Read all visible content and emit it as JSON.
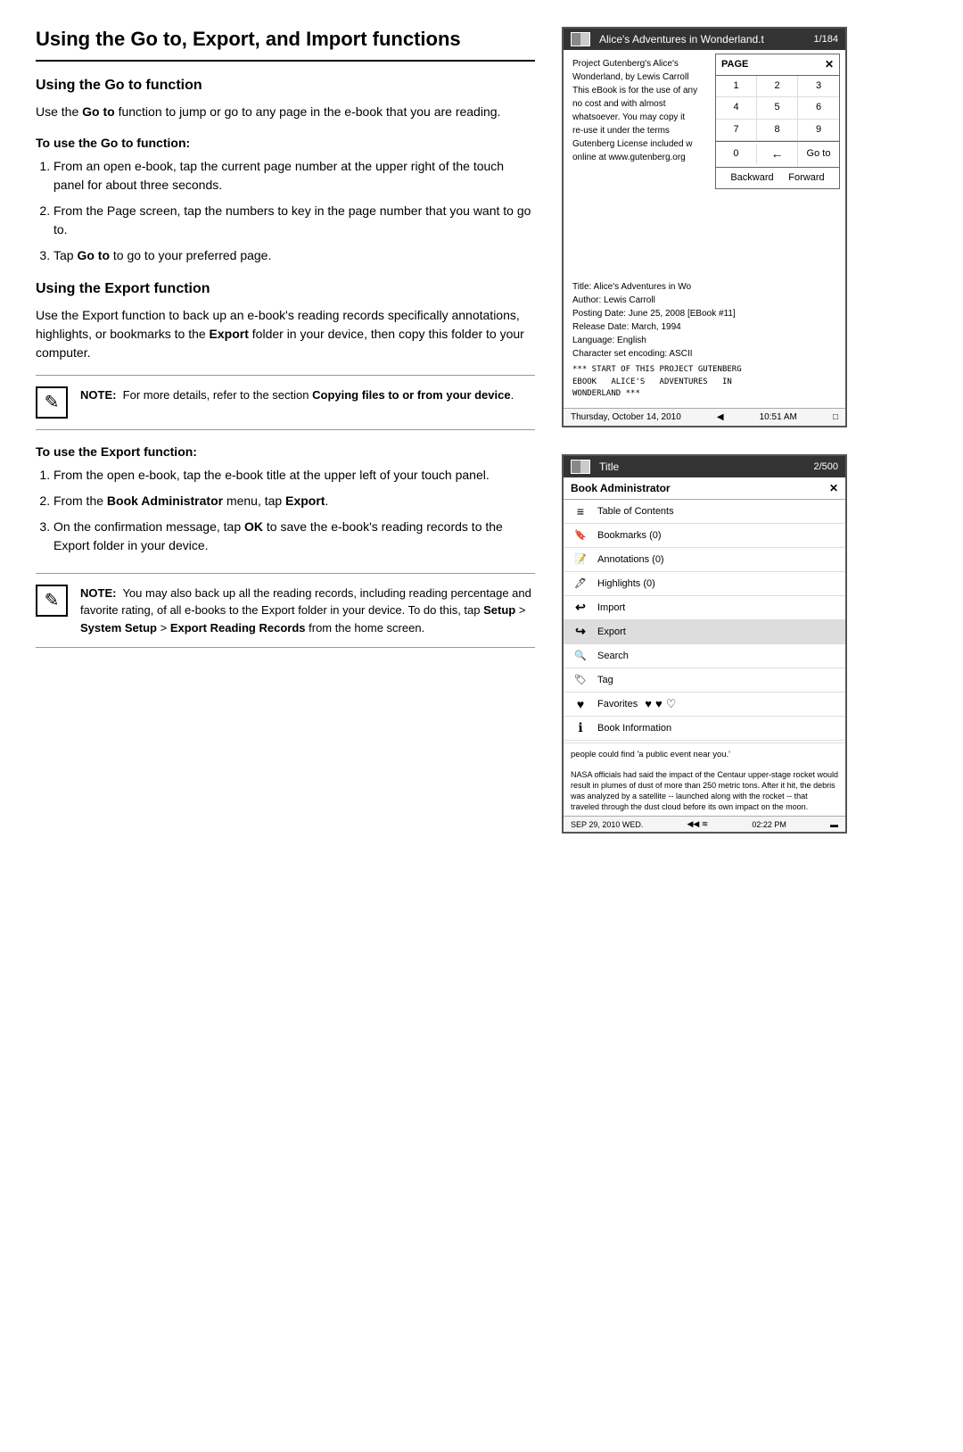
{
  "page": {
    "main_title": "Using the Go to, Export, and Import functions",
    "section1": {
      "title": "Using the Go to function",
      "body": "Use the Go to function to jump or go to any page in the e-book that you are reading.",
      "goto_bold": "Go to",
      "subsection_title": "To use the Go to function:",
      "steps": [
        "From an open e-book, tap the current page number at the upper right of the touch panel for about three seconds.",
        "From the Page screen, tap the numbers to key in the page number that you want to go to.",
        "Tap Go to to go to your preferred page."
      ],
      "step3_bold": "Go to"
    },
    "section2": {
      "title": "Using the Export function",
      "body": "Use the Export function to back up an e-book's reading records specifically annotations, highlights, or bookmarks to the Export folder in your device, then copy this folder to your computer.",
      "export_bold": "Export",
      "note": {
        "label": "NOTE:",
        "text": "For more details, refer to the section Copying files to or from your device.",
        "bold_part": "Copying files to or from your device"
      },
      "subsection_title": "To use the Export function:",
      "steps": [
        "From the open e-book, tap the e-book title at the upper left of your touch panel.",
        "From the Book Administrator menu, tap Export.",
        "On the confirmation message, tap OK to save the e-book's reading records to the Export folder in your device."
      ],
      "step2_bold": "Book Administrator",
      "step2_bold2": "Export",
      "step3_bold": "OK"
    },
    "note_bottom": {
      "label": "NOTE:",
      "text": "You may also back up all the reading records, including reading percentage and favorite rating, of all e-books to the Export folder in your device. To do this, tap Setup > System Setup > Export Reading Records from the home screen.",
      "bold_parts": [
        "Setup",
        "System Setup",
        "Export Reading Records"
      ]
    }
  },
  "device1": {
    "title": "Alice's Adventures in Wonderland.t",
    "page_label": "1/184",
    "body_text": "Project Gutenberg's Alice's Wonderland, by Lewis Carroll This eBook is for the use of any no cost and with almost whatsoever. You may copy it re-use it under the terms Gutenberg License included w online at www.gutenberg.org",
    "page_popup": {
      "header": "PAGE",
      "close": "✕",
      "numbers": [
        "1",
        "2",
        "3",
        "4",
        "5",
        "6",
        "7",
        "8",
        "9"
      ],
      "zero": "0",
      "back_arrow": "←",
      "goto": "Go to",
      "backward": "Backward",
      "forward": "Forward"
    },
    "book_info": [
      "Title: Alice's Adventures in Wo",
      "Author: Lewis Carroll",
      "Posting Date: June 25, 2008 [EBook #11]",
      "Release Date: March, 1994",
      "Language: English",
      "Character set encoding: ASCII",
      "*** START OF THIS PROJECT GUTENBERG EBOOK ALICE'S ADVENTURES IN WONDERLAND ***"
    ],
    "status": {
      "date": "Thursday, October 14, 2010",
      "time": "10:51 AM"
    }
  },
  "device2": {
    "title": "Title",
    "page_label": "2/500",
    "book_admin": {
      "label": "Book Administrator",
      "close": "✕"
    },
    "menu_items": [
      {
        "icon": "list",
        "label": "Table of Contents"
      },
      {
        "icon": "bookmark",
        "label": "Bookmarks (0)"
      },
      {
        "icon": "annotation",
        "label": "Annotations (0)"
      },
      {
        "icon": "highlight",
        "label": "Highlights (0)"
      },
      {
        "icon": "import",
        "label": "Import"
      },
      {
        "icon": "export",
        "label": "Export"
      },
      {
        "icon": "search",
        "label": "Search"
      },
      {
        "icon": "tag",
        "label": "Tag"
      },
      {
        "icon": "favorites",
        "label": "Favorites"
      },
      {
        "icon": "info",
        "label": "Book Information"
      }
    ],
    "body_preview": "people could find 'a public event near you.'",
    "news_text": "NASA officials had said the impact of the Centaur upper-stage rocket would result in plumes of dust of more than 250 metric tons. After it hit, the debris was analyzed by a satellite -- launched along with the rocket -- that traveled through the dust cloud before its own impact on the moon.",
    "status": {
      "date": "SEP 29, 2010  WED.",
      "time": "02:22 PM"
    }
  }
}
